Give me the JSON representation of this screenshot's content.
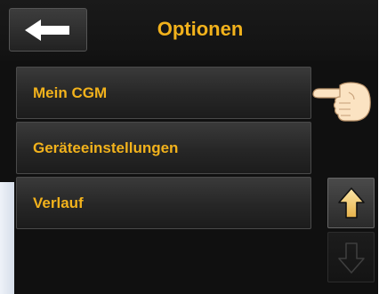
{
  "header": {
    "title": "Optionen"
  },
  "menu": {
    "items": [
      {
        "label": "Mein CGM"
      },
      {
        "label": "Geräteeinstellungen"
      },
      {
        "label": "Verlauf"
      }
    ]
  },
  "icons": {
    "back": "arrow-left-icon",
    "scroll_up": "arrow-up-icon",
    "scroll_down": "arrow-down-icon",
    "pointer": "pointing-hand-icon"
  },
  "colors": {
    "accent": "#f2b21c",
    "background": "#101010",
    "button": "#2a2a2a"
  }
}
